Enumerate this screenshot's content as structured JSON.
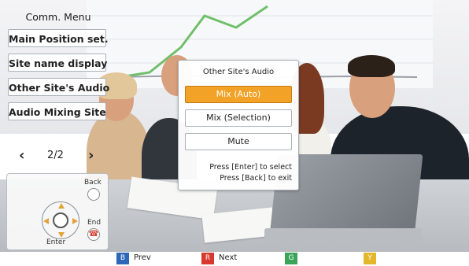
{
  "menu": {
    "title": "Comm. Menu",
    "items": [
      {
        "label": "Main Position set."
      },
      {
        "label": "Site name display"
      },
      {
        "label": "Other Site's Audio"
      },
      {
        "label": "Audio Mixing Site"
      }
    ],
    "pager": {
      "prev_icon": "chevron-left-icon",
      "text": "2/2",
      "next_icon": "chevron-right-icon"
    }
  },
  "remote": {
    "back_label": "Back",
    "end_label": "End",
    "enter_label": "Enter"
  },
  "dialog": {
    "title": "Other Site's Audio",
    "options": [
      {
        "label": "Mix (Auto)",
        "selected": true
      },
      {
        "label": "Mix (Selection)",
        "selected": false
      },
      {
        "label": "Mute",
        "selected": false
      }
    ],
    "hint_line1": "Press [Enter] to select",
    "hint_line2": "Press [Back] to exit"
  },
  "bottom_bar": {
    "keys": [
      {
        "key": "B",
        "label": "Prev",
        "color": "#2d67b8"
      },
      {
        "key": "R",
        "label": "Next",
        "color": "#d8392e"
      },
      {
        "key": "G",
        "label": "",
        "color": "#3aa55a"
      },
      {
        "key": "Y",
        "label": "",
        "color": "#e3b72b"
      }
    ]
  },
  "colors": {
    "selected_option": "#f2a226",
    "chart_line": "#6fbf6a",
    "dpad_arrows": "#e0a43a"
  }
}
